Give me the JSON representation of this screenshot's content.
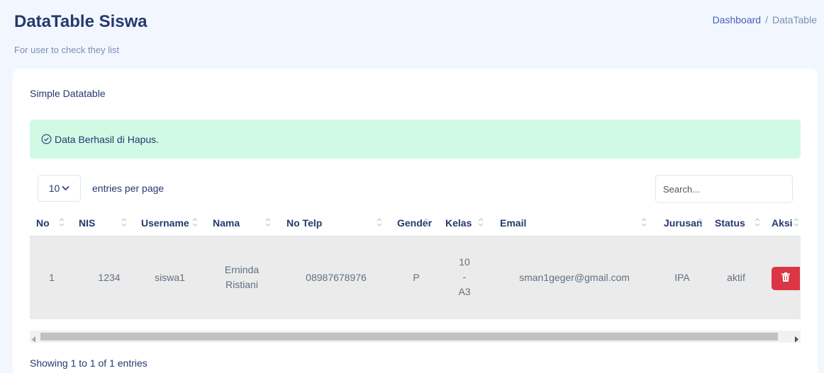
{
  "header": {
    "title": "DataTable Siswa",
    "subtitle": "For user to check they list",
    "breadcrumb": {
      "home": "Dashboard",
      "separator": "/",
      "current": "DataTable"
    }
  },
  "card": {
    "title": "Simple Datatable",
    "alert": {
      "icon": "check-circle-icon",
      "message": "Data Berhasil di Hapus.",
      "color": "#d1fae5"
    }
  },
  "controls": {
    "per_page_value": "10",
    "per_page_label": "entries per page",
    "search_placeholder": "Search..."
  },
  "table": {
    "columns": [
      "No",
      "NIS",
      "Username",
      "Nama",
      "No Telp",
      "Gender",
      "Kelas",
      "Email",
      "Jurusan",
      "Status",
      "Aksi"
    ],
    "rows": [
      {
        "no": "1",
        "nis": "1234",
        "username": "siswa1",
        "nama_line1": "Erninda",
        "nama_line2": "Ristiani",
        "telp": "08987678976",
        "gender": "P",
        "kelas_line1": "10",
        "kelas_line2": "-",
        "kelas_line3": "A3",
        "email": "sman1geger@gmail.com",
        "jurusan": "IPA",
        "status": "aktif",
        "action_icon": "trash-icon"
      }
    ]
  },
  "footer": {
    "info": "Showing 1 to 1 of 1 entries"
  },
  "colors": {
    "background": "#f2f7ff",
    "primary_text": "#25396f",
    "danger": "#dc3545",
    "row_bg": "#ebebeb"
  }
}
